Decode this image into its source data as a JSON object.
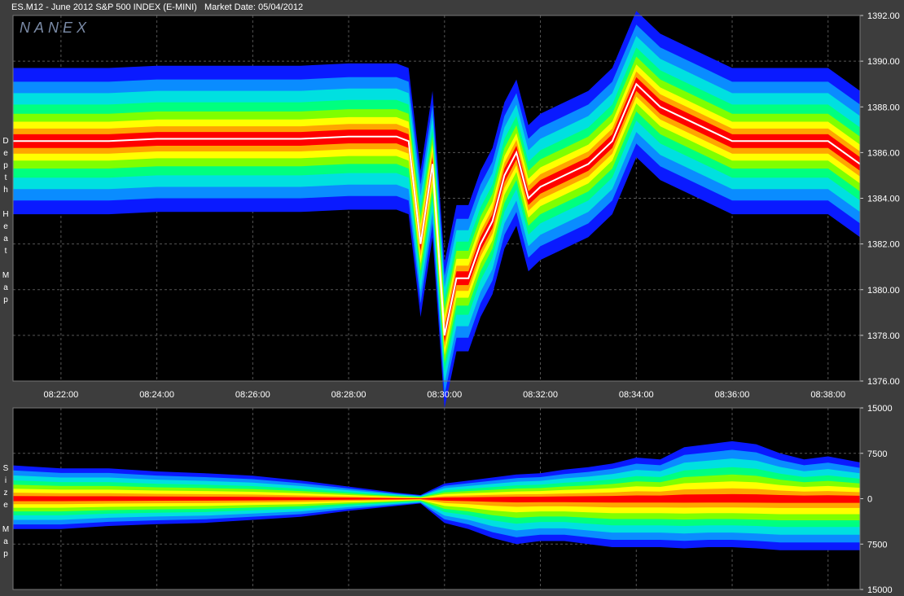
{
  "header": {
    "symbol": "ES.M12 - June 2012 S&P 500 INDEX (E-MINI)",
    "market_date": "Market Date: 05/04/2012",
    "watermark": "NANEX"
  },
  "colors": {
    "background": "#000000",
    "frame": "#3d3d3d",
    "grid": "#555555",
    "price_line": "#ffffff",
    "heat_scale": [
      "#0a1aff",
      "#0a8cff",
      "#00e0e0",
      "#00ff7f",
      "#7fff00",
      "#ffff00",
      "#ffa500",
      "#ff0000"
    ]
  },
  "chart_data": [
    {
      "type": "heatmap",
      "title": "Depth Heat Map",
      "side_label": "Depth Heat Map",
      "x_ticks": [
        "08:22:00",
        "08:24:00",
        "08:26:00",
        "08:28:00",
        "08:30:00",
        "08:32:00",
        "08:34:00",
        "08:36:00",
        "08:38:00"
      ],
      "y_ticks": [
        "1376.00",
        "1378.00",
        "1380.00",
        "1382.00",
        "1384.00",
        "1386.00",
        "1388.00",
        "1390.00",
        "1392.00"
      ],
      "xlim": [
        "08:21:00",
        "08:38:40"
      ],
      "ylim": [
        1376,
        1392
      ],
      "grid": true,
      "series": [
        {
          "x": [
            "08:21:00",
            "08:22:00",
            "08:23:00",
            "08:24:00",
            "08:25:00",
            "08:26:00",
            "08:27:00",
            "08:28:00",
            "08:29:00",
            "08:29:15",
            "08:29:30",
            "08:29:45",
            "08:30:00",
            "08:30:15",
            "08:30:30",
            "08:30:45",
            "08:31:00",
            "08:31:15",
            "08:31:30",
            "08:31:45",
            "08:32:00",
            "08:32:30",
            "08:33:00",
            "08:33:30",
            "08:34:00",
            "08:34:30",
            "08:35:00",
            "08:35:30",
            "08:36:00",
            "08:36:30",
            "08:37:00",
            "08:37:30",
            "08:38:00",
            "08:38:40"
          ],
          "y": [
            1386.5,
            1386.5,
            1386.5,
            1386.6,
            1386.6,
            1386.6,
            1386.6,
            1386.7,
            1386.7,
            1386.5,
            1382.0,
            1385.5,
            1378.0,
            1380.5,
            1380.5,
            1382.0,
            1383.0,
            1385.0,
            1386.0,
            1384.0,
            1384.5,
            1385.0,
            1385.5,
            1386.5,
            1389.0,
            1388.0,
            1387.5,
            1387.0,
            1386.5,
            1386.5,
            1386.5,
            1386.5,
            1386.5,
            1385.5
          ]
        }
      ]
    },
    {
      "type": "area",
      "title": "Size Map",
      "side_label": "Size Map",
      "y_ticks": [
        "15000",
        "7500",
        "0",
        "7500",
        "15000"
      ],
      "ylim": [
        -15000,
        15000
      ],
      "grid": true,
      "series": [
        {
          "x": [
            "08:21:00",
            "08:22:00",
            "08:23:00",
            "08:24:00",
            "08:25:00",
            "08:26:00",
            "08:27:00",
            "08:28:00",
            "08:29:00",
            "08:29:30",
            "08:30:00",
            "08:30:30",
            "08:31:00",
            "08:31:30",
            "08:32:00",
            "08:32:30",
            "08:33:00",
            "08:33:30",
            "08:34:00",
            "08:34:30",
            "08:35:00",
            "08:35:30",
            "08:36:00",
            "08:36:30",
            "08:37:00",
            "08:37:30",
            "08:38:00",
            "08:38:40"
          ],
          "upper": [
            5500,
            5000,
            5000,
            4500,
            4200,
            3800,
            3000,
            2000,
            1000,
            600,
            2500,
            3000,
            3500,
            4000,
            4200,
            4800,
            5200,
            5800,
            6800,
            6500,
            8500,
            9000,
            9500,
            9000,
            7500,
            6500,
            7000,
            6000
          ],
          "lower": [
            -5000,
            -5000,
            -4500,
            -4200,
            -4000,
            -3500,
            -3000,
            -2000,
            -1200,
            -800,
            -4000,
            -5000,
            -6500,
            -7500,
            -7000,
            -7000,
            -7500,
            -8000,
            -8000,
            -8000,
            -8200,
            -8000,
            -8000,
            -8200,
            -8500,
            -8500,
            -8500,
            -8500
          ]
        }
      ]
    }
  ]
}
